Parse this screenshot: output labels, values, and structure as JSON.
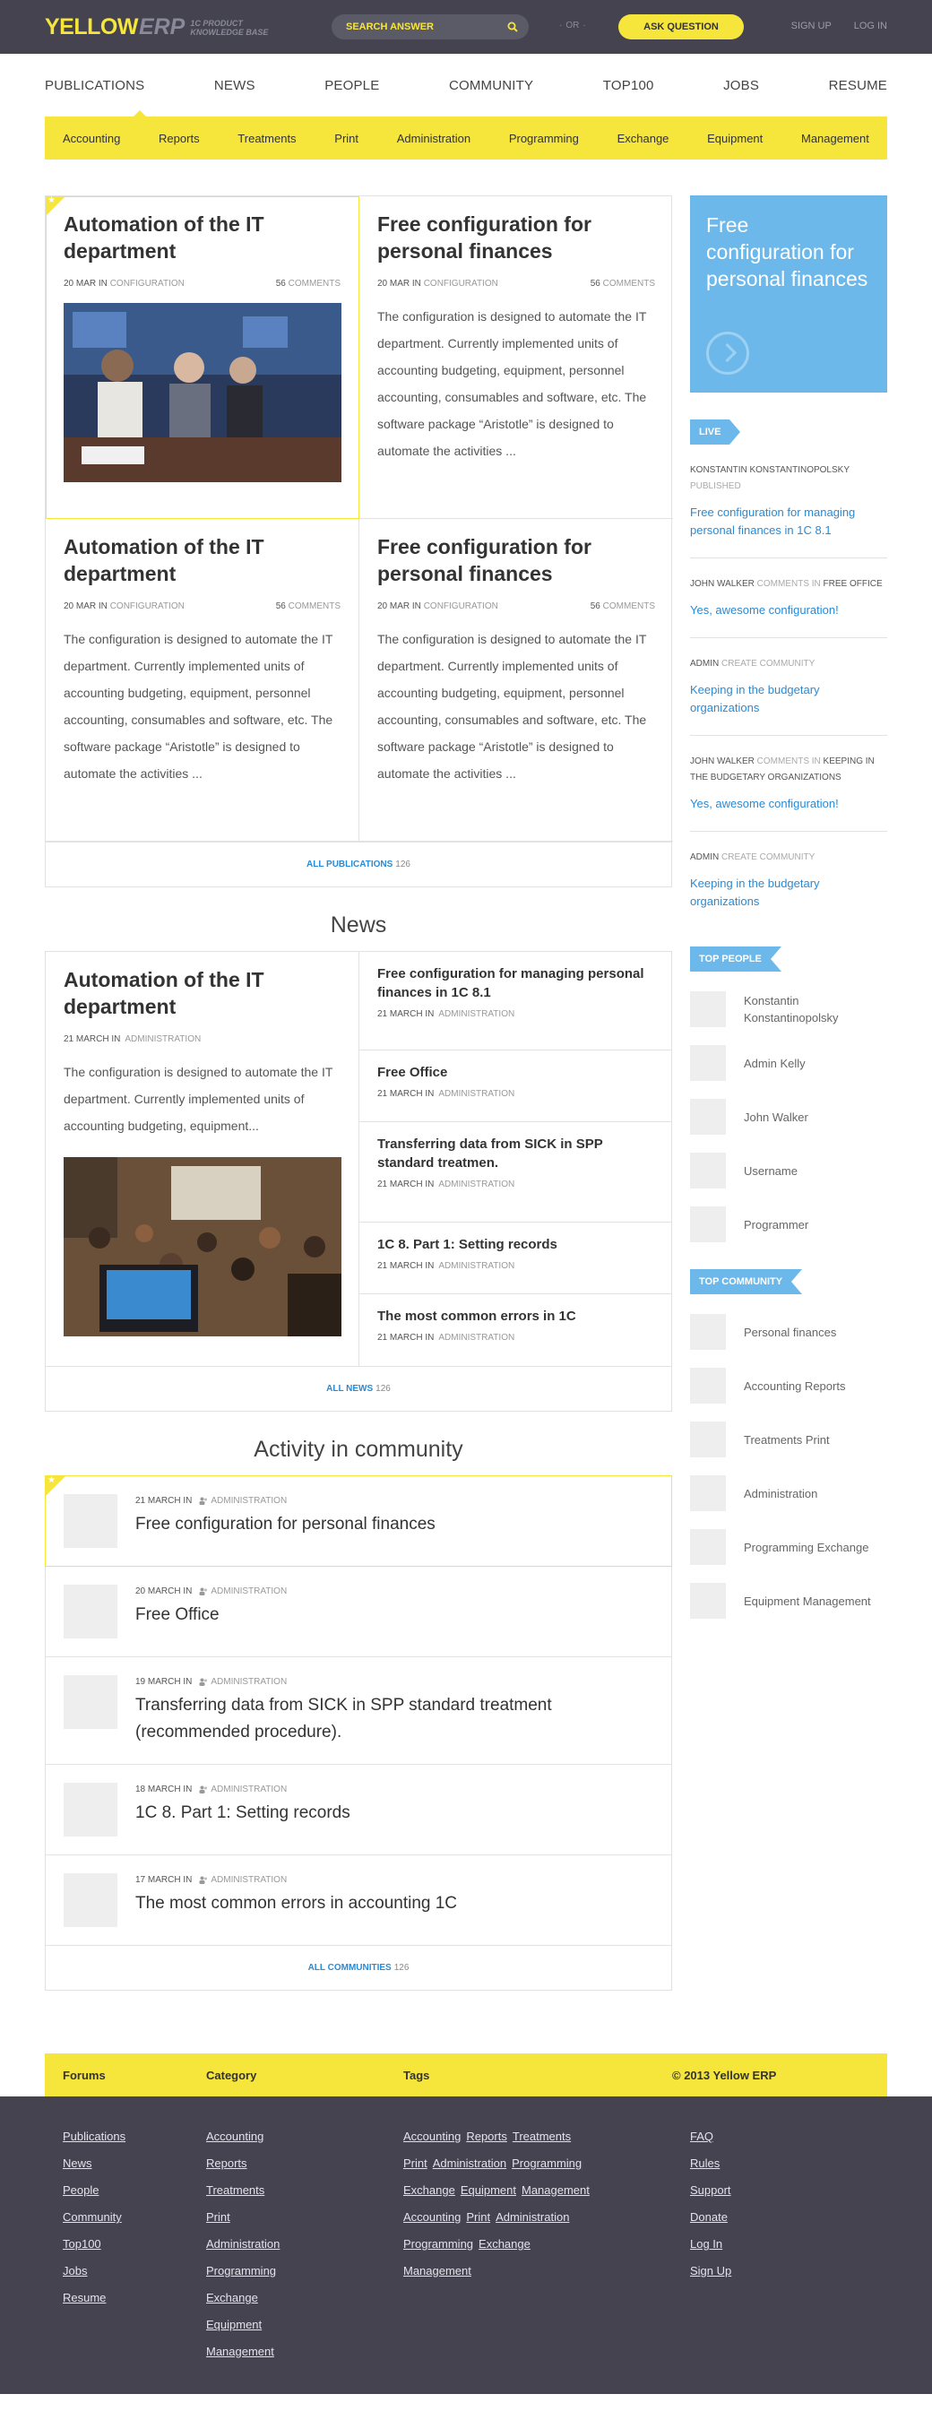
{
  "header": {
    "logo_main": "YELLOW",
    "logo_sub": "ERP",
    "logo_tag_1": "1C PRODUCT",
    "logo_tag_2": "KNOWLEDGE BASE",
    "search_placeholder": "SEARCH ANSWER",
    "or_label": "OR",
    "ask_label": "ASK QUESTION",
    "signup_label": "SIGN UP",
    "login_label": "LOG IN"
  },
  "nav": {
    "items": [
      "PUBLICATIONS",
      "NEWS",
      "PEOPLE",
      "COMMUNITY",
      "TOP100",
      "JOBS",
      "RESUME"
    ],
    "sub_items": [
      "Accounting",
      "Reports",
      "Treatments",
      "Print",
      "Administration",
      "Programming",
      "Exchange",
      "Equipment",
      "Management"
    ]
  },
  "publications": {
    "cards": [
      {
        "title": "Automation of the IT department",
        "date": "20 MAR IN",
        "category": "CONFIGURATION",
        "comments_count": "56",
        "comments_label": "COMMENTS"
      },
      {
        "title": "Free configuration for personal finances",
        "date": "20 MAR IN",
        "category": "CONFIGURATION",
        "comments_count": "56",
        "comments_label": "COMMENTS",
        "text": "The configuration is designed to automate the IT department. Currently implemented units of accounting budgeting, equipment, personnel accounting, consumables and software, etc. The software package “Aristotle” is designed to automate the activities ..."
      },
      {
        "title": "Automation of the IT department",
        "date": "20 MAR IN",
        "category": "CONFIGURATION",
        "comments_count": "56",
        "comments_label": "COMMENTS",
        "text": "The configuration is designed to automate the IT department. Currently implemented units of accounting budgeting, equipment, personnel accounting, consumables and software, etc. The software package “Aristotle” is designed to automate the activities ..."
      },
      {
        "title": "Free configuration for personal finances",
        "date": "20 MAR IN",
        "category": "CONFIGURATION",
        "comments_count": "56",
        "comments_label": "COMMENTS",
        "text": "The configuration is designed to automate the IT department. Currently implemented units of accounting budgeting, equipment, personnel accounting, consumables and software, etc. The software package “Aristotle” is designed to automate the activities ..."
      }
    ],
    "all_label": "ALL PUBLICATIONS",
    "all_count": "126"
  },
  "news": {
    "section_title": "News",
    "main": {
      "title": "Automation of the IT department",
      "date": "21 MARCH IN",
      "category": "ADMINISTRATION",
      "text": "The configuration is designed to automate the IT department. Currently implemented units of accounting budgeting, equipment..."
    },
    "items": [
      {
        "title": "Free configuration for managing personal finances in 1C 8.1",
        "date": "21 MARCH IN",
        "category": "ADMINISTRATION"
      },
      {
        "title": "Free Office",
        "date": "21 MARCH IN",
        "category": "ADMINISTRATION"
      },
      {
        "title": "Transferring data from SICK in SPP standard treatmen.",
        "date": "21 MARCH IN",
        "category": "ADMINISTRATION"
      },
      {
        "title": "1C 8. Part 1: Setting records",
        "date": "21 MARCH IN",
        "category": "ADMINISTRATION"
      },
      {
        "title": "The most common errors in 1C",
        "date": "21 MARCH IN",
        "category": "ADMINISTRATION"
      }
    ],
    "all_label": "ALL NEWS",
    "all_count": "126"
  },
  "community": {
    "section_title": "Activity in community",
    "items": [
      {
        "date": "21 MARCH IN",
        "author": "ADMINISTRATION",
        "title": "Free configuration for personal finances"
      },
      {
        "date": "20 MARCH IN",
        "author": "ADMINISTRATION",
        "title": "Free Office"
      },
      {
        "date": "19 MARCH IN",
        "author": "ADMINISTRATION",
        "title": "Transferring data from SICK in SPP standard treatment (recommended procedure)."
      },
      {
        "date": "18 MARCH IN",
        "author": "ADMINISTRATION",
        "title": "1C 8. Part 1: Setting records"
      },
      {
        "date": "17 MARCH IN",
        "author": "ADMINISTRATION",
        "title": "The most common errors in accounting 1C"
      }
    ],
    "all_label": "ALL COMMUNITIES",
    "all_count": "126"
  },
  "sidebar": {
    "promo_title": "Free configuration for personal finances",
    "live_label": "LIVE",
    "live": [
      {
        "user": "KONSTANTIN KONSTANTINOPOLSKY",
        "action": "PUBLISHED",
        "target": "",
        "link": "Free configuration for managing personal finances in 1C 8.1"
      },
      {
        "user": "JOHN WALKER",
        "action": "COMMENTS IN",
        "target": "FREE OFFICE",
        "link": "Yes, awesome configuration!"
      },
      {
        "user": "ADMIN",
        "action": "CREATE COMMUNITY",
        "target": "",
        "link": "Keeping in the budgetary organizations"
      },
      {
        "user": "JOHN WALKER",
        "action": "COMMENTS IN",
        "target": "KEEPING IN THE BUDGETARY ORGANIZATIONS",
        "link": "Yes, awesome configuration!"
      },
      {
        "user": "ADMIN",
        "action": "CREATE COMMUNITY",
        "target": "",
        "link": "Keeping in the budgetary organizations"
      }
    ],
    "top_people_label": "TOP PEOPLE",
    "top_people": [
      "Konstantin Konstantinopolsky",
      "Admin Kelly",
      "John Walker",
      "Username",
      "Programmer"
    ],
    "top_community_label": "TOP COMMUNITY",
    "top_community": [
      "Personal finances",
      "Accounting Reports",
      "Treatments Print",
      "Administration",
      "Programming Exchange",
      "Equipment Management"
    ]
  },
  "footer": {
    "forums_label": "Forums",
    "category_label": "Category",
    "tags_label": "Tags",
    "copyright": "© 2013 Yellow ERP",
    "forums": [
      "Publications",
      "News",
      "People",
      "Community",
      "Top100",
      "Jobs",
      "Resume"
    ],
    "categories": [
      "Accounting",
      "Reports",
      "Treatments",
      "Print",
      "Administration",
      "Programming",
      "Exchange",
      "Equipment",
      "Management"
    ],
    "tag_rows": [
      [
        "Accounting",
        "Reports",
        "Treatments"
      ],
      [
        "Print",
        "Administration",
        "Programming"
      ],
      [
        "Exchange",
        "Equipment",
        "Management"
      ],
      [
        "Accounting",
        "Print",
        "Administration"
      ],
      [
        "Programming",
        "Exchange"
      ],
      [
        "Management"
      ]
    ],
    "links": [
      "FAQ",
      "Rules",
      "Support",
      "Donate",
      "Log In",
      "Sign Up"
    ]
  },
  "colors": {
    "brand_yellow": "#f6e63c",
    "header_bg": "#44434f",
    "accent_blue": "#6cb8ea",
    "link_blue": "#2a8ad4"
  }
}
